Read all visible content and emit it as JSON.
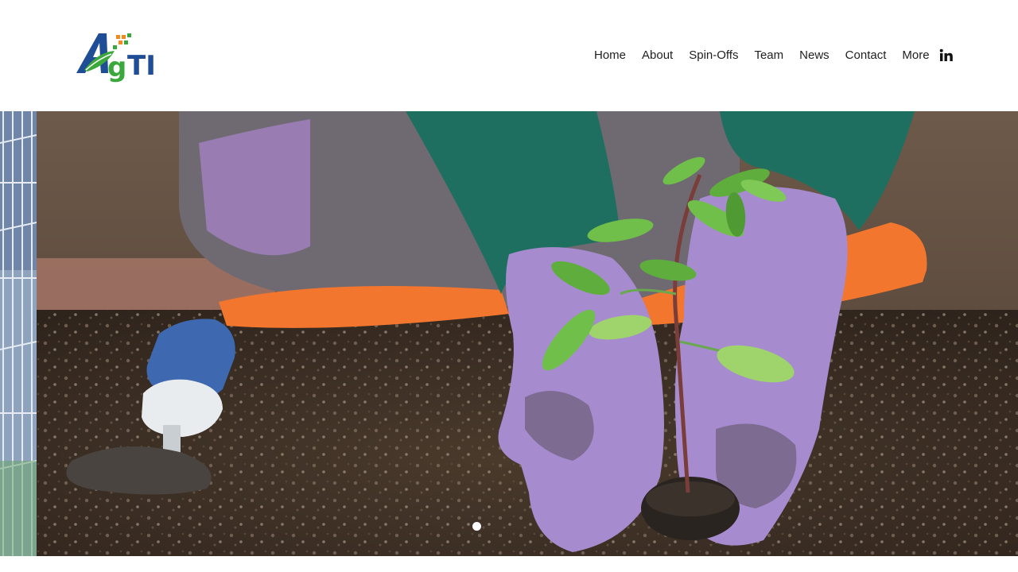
{
  "brand": {
    "logo_text": "AgTI",
    "colors": {
      "brand_blue": "#1f4e96",
      "brand_green": "#3aa83a",
      "brand_orange": "#f28a1e"
    }
  },
  "nav": {
    "items": [
      {
        "label": "Home"
      },
      {
        "label": "About"
      },
      {
        "label": "Spin-Offs"
      },
      {
        "label": "Team"
      },
      {
        "label": "News"
      },
      {
        "label": "Contact"
      },
      {
        "label": "More"
      }
    ]
  },
  "social": {
    "linkedin_icon": "linkedin-icon"
  },
  "slideshow": {
    "current_slide": 1,
    "dots": 1
  }
}
